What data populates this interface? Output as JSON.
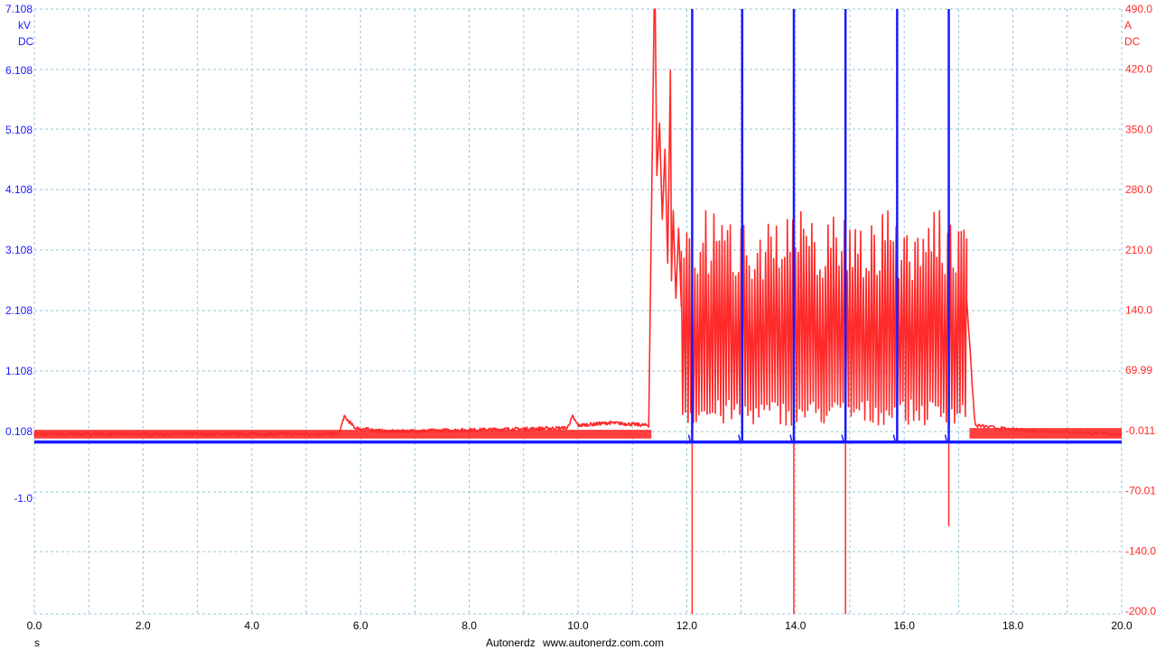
{
  "chart_data": {
    "type": "line",
    "left_axis": {
      "unit": "kV",
      "coupling": "DC",
      "ticks": [
        "7.108",
        "6.108",
        "5.108",
        "4.108",
        "3.108",
        "2.108",
        "1.108",
        "0.108",
        "-1.0"
      ],
      "range": [
        -2.9,
        7.108
      ],
      "color": "#1a1aff"
    },
    "right_axis": {
      "unit": "A",
      "coupling": "DC",
      "ticks": [
        "490.0",
        "420.0",
        "350.0",
        "280.0",
        "210.0",
        "140.0",
        "69.99",
        "-0.011",
        "-70.01",
        "-140.0",
        "-200.0"
      ],
      "range": [
        -200.0,
        490.0
      ],
      "color": "#ff2a2a"
    },
    "x_axis": {
      "unit": "s",
      "ticks": [
        "0.0",
        "2.0",
        "4.0",
        "6.0",
        "8.0",
        "10.0",
        "12.0",
        "14.0",
        "16.0",
        "18.0",
        "20.0"
      ],
      "range": [
        0,
        20
      ]
    },
    "grid": true,
    "series": [
      {
        "color": "#1a1aff",
        "axis": "left",
        "baseline_kv": -0.05,
        "spikes_s": [
          12.1,
          13.02,
          13.97,
          14.92,
          15.87,
          16.82
        ],
        "spike_peak_kv": 7.108
      },
      {
        "color": "#ff2a2a",
        "axis": "right",
        "x": [
          0,
          5.6,
          5.7,
          5.9,
          6.5,
          9.8,
          9.9,
          10.0,
          10.6,
          11.3,
          11.4,
          11.5,
          11.9,
          12.5,
          13.5,
          14.5,
          15.5,
          16.5,
          17.15,
          17.3,
          18.0,
          20.0
        ],
        "y": [
          5,
          5,
          25,
          12,
          8,
          12,
          25,
          15,
          18,
          15,
          490,
          300,
          200,
          160,
          160,
          160,
          160,
          160,
          160,
          15,
          10,
          5
        ],
        "oscillation_band": [
          11.9,
          17.15
        ],
        "oscillation_low": 15,
        "oscillation_high": 260,
        "negative_spikes_s": [
          12.1,
          13.97,
          14.92,
          16.82
        ],
        "negative_spike_min": [
          -200,
          -200,
          -200,
          -100
        ]
      }
    ]
  },
  "footer": {
    "brand": "Autonerdz",
    "url": "www.autonerdz.com.com"
  }
}
